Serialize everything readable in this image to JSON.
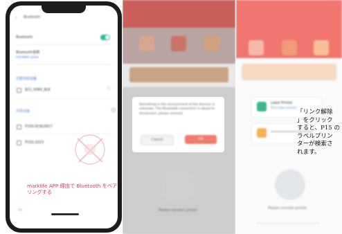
{
  "panel1": {
    "header_title": "Bluetooth",
    "rows": [
      {
        "label": "Bluetooth",
        "toggle": "on"
      },
      {
        "label": "Bluetooth名称",
        "sub": "niimbot-xxxx"
      }
    ],
    "paired_header": "已配对的设备",
    "paired_device": "B21_0080_BLE",
    "available_header": "可用设备",
    "available_devices": [
      "P15S-0C8L0817",
      "P15S-1023"
    ],
    "caption": "marklife APP 経由で Bluetooth をペアリングする"
  },
  "panel2": {
    "dialog_text": "Something in the environment of the devices is unknown. The Bluetooth connection is about to disconnect, please connect.",
    "cancel_label": "Cancel",
    "confirm_label": "OK",
    "bottom_label": "Please connect printer"
  },
  "panel3": {
    "card_title": "Label Printer",
    "card_sub": "P15 Label printer",
    "bottom_label": "Please connect printer",
    "caption": "「リンク解除」をクリックすると、P15 のラベルプリンターが検索されます。",
    "caption_lines": [
      "「リンク解除",
      "」をクリック",
      "すると、P15 の",
      "ラベルプリン",
      "ターが検索さ",
      "れます。"
    ]
  },
  "colors": {
    "red_header": "#c95f58",
    "coral_header": "#f1766f",
    "teal_toggle": "#2fb89b",
    "caption_red": "#d33d5c"
  }
}
